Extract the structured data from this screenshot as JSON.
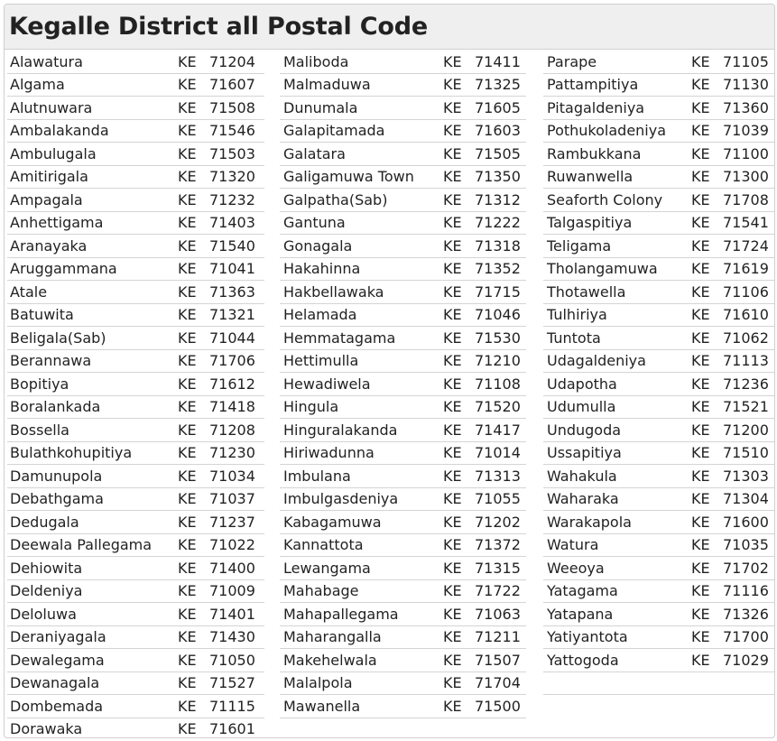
{
  "title": "Kegalle District all Postal Code",
  "district_code": "KE",
  "columns": [
    [
      {
        "name": "Alawatura",
        "code": "71204"
      },
      {
        "name": "Algama",
        "code": "71607"
      },
      {
        "name": "Alutnuwara",
        "code": "71508"
      },
      {
        "name": "Ambalakanda",
        "code": "71546"
      },
      {
        "name": "Ambulugala",
        "code": "71503"
      },
      {
        "name": "Amitirigala",
        "code": "71320"
      },
      {
        "name": "Ampagala",
        "code": "71232"
      },
      {
        "name": "Anhettigama",
        "code": "71403"
      },
      {
        "name": "Aranayaka",
        "code": "71540"
      },
      {
        "name": "Aruggammana",
        "code": "71041"
      },
      {
        "name": "Atale",
        "code": "71363"
      },
      {
        "name": "Batuwita",
        "code": "71321"
      },
      {
        "name": "Beligala(Sab)",
        "code": "71044"
      },
      {
        "name": "Berannawa",
        "code": "71706"
      },
      {
        "name": "Bopitiya",
        "code": "71612"
      },
      {
        "name": "Boralankada",
        "code": "71418"
      },
      {
        "name": "Bossella",
        "code": "71208"
      },
      {
        "name": "Bulathkohupitiya",
        "code": "71230"
      },
      {
        "name": "Damunupola",
        "code": "71034"
      },
      {
        "name": "Debathgama",
        "code": "71037"
      },
      {
        "name": "Dedugala",
        "code": "71237"
      },
      {
        "name": "Deewala Pallegama",
        "code": "71022"
      },
      {
        "name": "Dehiowita",
        "code": "71400"
      },
      {
        "name": "Deldeniya",
        "code": "71009"
      },
      {
        "name": "Deloluwa",
        "code": "71401"
      },
      {
        "name": "Deraniyagala",
        "code": "71430"
      },
      {
        "name": "Dewalegama",
        "code": "71050"
      },
      {
        "name": "Dewanagala",
        "code": "71527"
      },
      {
        "name": "Dombemada",
        "code": "71115"
      },
      {
        "name": "Dorawaka",
        "code": "71601"
      }
    ],
    [
      {
        "name": "Maliboda",
        "code": "71411"
      },
      {
        "name": "Malmaduwa",
        "code": "71325"
      },
      {
        "name": "Dunumala",
        "code": "71605"
      },
      {
        "name": "Galapitamada",
        "code": "71603"
      },
      {
        "name": "Galatara",
        "code": "71505"
      },
      {
        "name": "Galigamuwa Town",
        "code": "71350"
      },
      {
        "name": "Galpatha(Sab)",
        "code": "71312"
      },
      {
        "name": "Gantuna",
        "code": "71222"
      },
      {
        "name": "Gonagala",
        "code": "71318"
      },
      {
        "name": "Hakahinna",
        "code": "71352"
      },
      {
        "name": "Hakbellawaka",
        "code": "71715"
      },
      {
        "name": "Helamada",
        "code": "71046"
      },
      {
        "name": "Hemmatagama",
        "code": "71530"
      },
      {
        "name": "Hettimulla",
        "code": "71210"
      },
      {
        "name": "Hewadiwela",
        "code": "71108"
      },
      {
        "name": "Hingula",
        "code": "71520"
      },
      {
        "name": "Hinguralakanda",
        "code": "71417"
      },
      {
        "name": "Hiriwadunna",
        "code": "71014"
      },
      {
        "name": "Imbulana",
        "code": "71313"
      },
      {
        "name": "Imbulgasdeniya",
        "code": "71055"
      },
      {
        "name": "Kabagamuwa",
        "code": "71202"
      },
      {
        "name": "Kannattota",
        "code": "71372"
      },
      {
        "name": "Lewangama",
        "code": "71315"
      },
      {
        "name": "Mahabage",
        "code": "71722"
      },
      {
        "name": "Mahapallegama",
        "code": "71063"
      },
      {
        "name": "Maharangalla",
        "code": "71211"
      },
      {
        "name": "Makehelwala",
        "code": "71507"
      },
      {
        "name": "Malalpola",
        "code": "71704"
      },
      {
        "name": "Mawanella",
        "code": "71500"
      }
    ],
    [
      {
        "name": "Parape",
        "code": "71105"
      },
      {
        "name": "Pattampitiya",
        "code": "71130"
      },
      {
        "name": "Pitagaldeniya",
        "code": "71360"
      },
      {
        "name": "Pothukoladeniya",
        "code": "71039"
      },
      {
        "name": "Rambukkana",
        "code": "71100"
      },
      {
        "name": "Ruwanwella",
        "code": "71300"
      },
      {
        "name": "Seaforth Colony",
        "code": "71708"
      },
      {
        "name": "Talgaspitiya",
        "code": "71541"
      },
      {
        "name": "Teligama",
        "code": "71724"
      },
      {
        "name": "Tholangamuwa",
        "code": "71619"
      },
      {
        "name": "Thotawella",
        "code": "71106"
      },
      {
        "name": "Tulhiriya",
        "code": "71610"
      },
      {
        "name": "Tuntota",
        "code": "71062"
      },
      {
        "name": "Udagaldeniya",
        "code": "71113"
      },
      {
        "name": "Udapotha",
        "code": "71236"
      },
      {
        "name": "Udumulla",
        "code": "71521"
      },
      {
        "name": "Undugoda",
        "code": "71200"
      },
      {
        "name": "Ussapitiya",
        "code": "71510"
      },
      {
        "name": "Wahakula",
        "code": "71303"
      },
      {
        "name": "Waharaka",
        "code": "71304"
      },
      {
        "name": "Warakapola",
        "code": "71600"
      },
      {
        "name": "Watura",
        "code": "71035"
      },
      {
        "name": "Weeoya",
        "code": "71702"
      },
      {
        "name": "Yatagama",
        "code": "71116"
      },
      {
        "name": "Yatapana",
        "code": "71326"
      },
      {
        "name": "Yatiyantota",
        "code": "71700"
      },
      {
        "name": "Yattogoda",
        "code": "71029"
      }
    ]
  ]
}
